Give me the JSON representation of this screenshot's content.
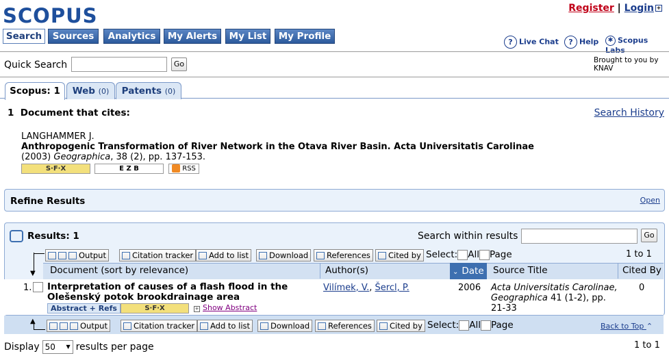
{
  "header": {
    "logo": "SCOPUS",
    "register": "Register",
    "separator": "|",
    "login": "Login",
    "nav": [
      "Search",
      "Sources",
      "Analytics",
      "My Alerts",
      "My List",
      "My Profile"
    ],
    "live_chat": "Live Chat",
    "help": "Help",
    "labs": "Scopus Labs"
  },
  "quick_search": {
    "label": "Quick Search",
    "value": "",
    "go": "Go",
    "brought": "Brought to you by KNAV"
  },
  "tabs": [
    {
      "label": "Scopus: 1",
      "count": ""
    },
    {
      "label": "Web",
      "count": "(0)"
    },
    {
      "label": "Patents",
      "count": "(0)"
    }
  ],
  "citing": {
    "heading": "1  Document that cites:",
    "search_history": "Search History",
    "author": "LANGHAMMER J.",
    "title": "Anthropogenic Transformation of River Network in the Otava River Basin. Acta Universitatis Carolinae",
    "year": "(2003)",
    "journal": "Geographica",
    "details": ", 38 (2), pp. 137-153.",
    "sfx": "S·F·X",
    "ezb": "E Z B",
    "rss": "RSS"
  },
  "refine": {
    "title": "Refine Results",
    "open": "Open"
  },
  "results": {
    "title": "Results: 1",
    "search_within": "Search within results",
    "go": "Go",
    "toolbar": {
      "output": "Output",
      "citation_tracker": "Citation tracker",
      "add_to_list": "Add to list",
      "download": "Download",
      "references": "References",
      "cited_by": "Cited by",
      "select": "Select:",
      "all": "All",
      "page": "Page"
    },
    "pager": "1 to 1",
    "columns": {
      "document": "Document (sort by relevance)",
      "authors": "Author(s)",
      "date": "Date",
      "source": "Source Title",
      "cited_by": "Cited By"
    },
    "row": {
      "num": "1.",
      "title": "Interpretation of causes of a flash flood in the Olešenský potok brookdrainage area",
      "author1": "Vilímek, V.",
      "author_sep": ", ",
      "author2": "Šercl, P.",
      "year": "2006",
      "source": "Acta Universitatis Carolinae, Geographica",
      "source_details": " 41 (1-2), pp. 21-33",
      "cited": "0",
      "abstract_refs": "Abstract + Refs",
      "show_abstract": "Show Abstract"
    },
    "back_to_top": "Back to Top",
    "display_label": "Display",
    "display_value": "50",
    "display_suffix": "results per page"
  }
}
